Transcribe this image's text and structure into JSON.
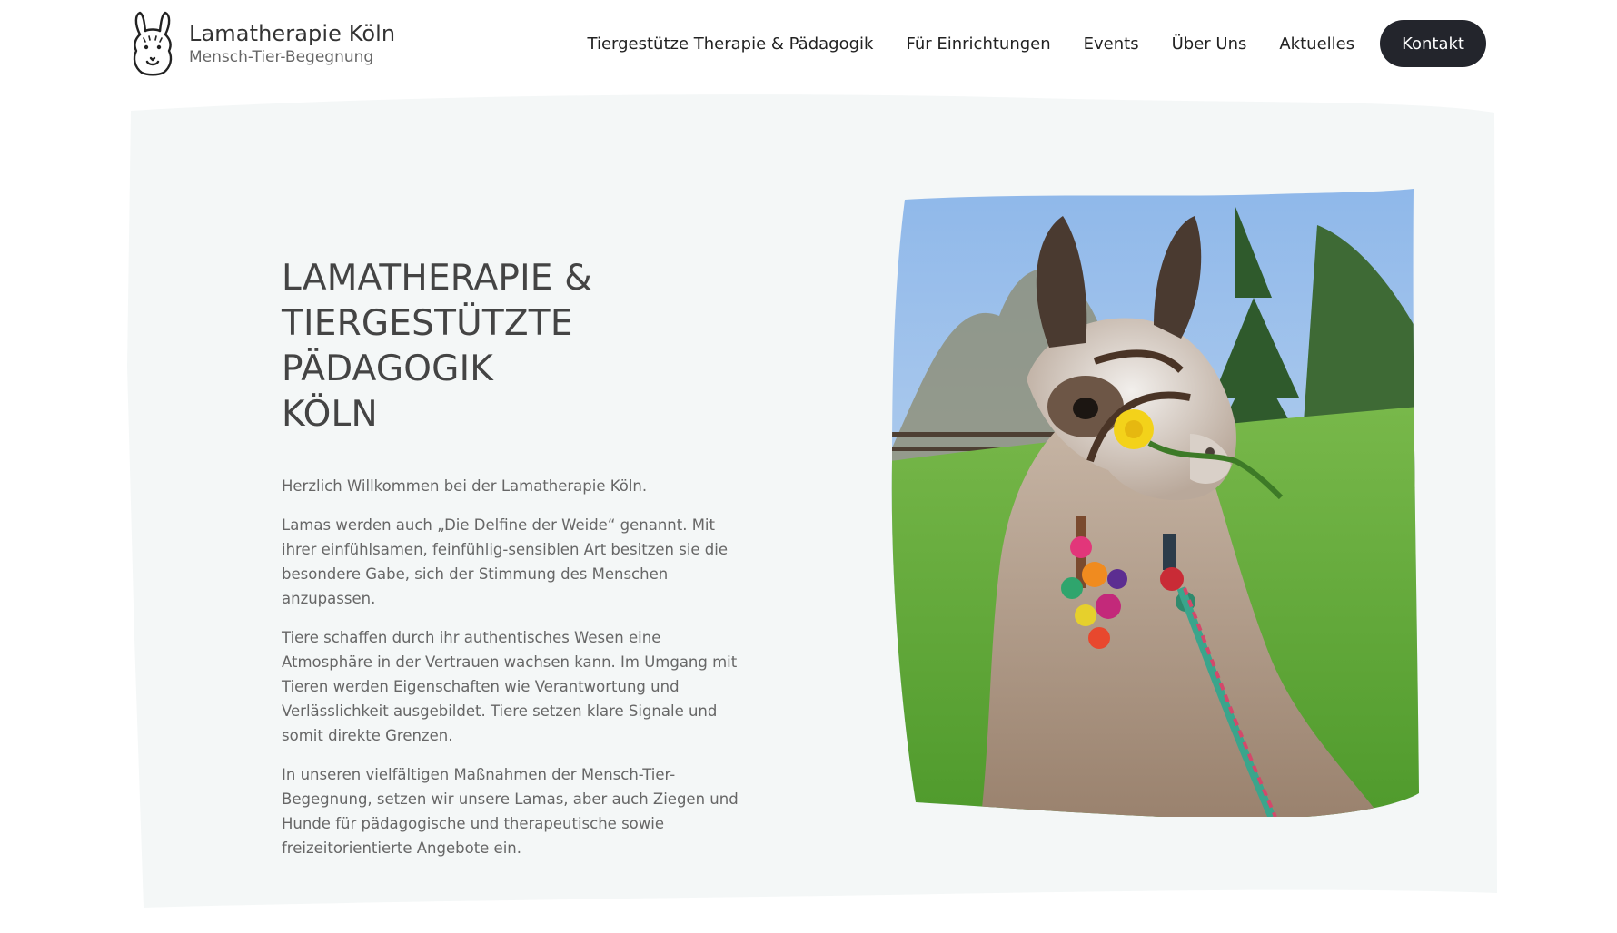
{
  "header": {
    "logo": {
      "icon": "llama-head-icon",
      "title": "Lamatherapie Köln",
      "subtitle": "Mensch-Tier-Begegnung"
    },
    "nav": [
      {
        "label": "Tiergestütze Therapie & Pädagogik"
      },
      {
        "label": "Für Einrichtungen"
      },
      {
        "label": "Events"
      },
      {
        "label": "Über Uns"
      },
      {
        "label": "Aktuelles"
      }
    ],
    "cta_label": "Kontakt"
  },
  "hero": {
    "title_lines": [
      "LAMATHERAPIE &",
      "TIERGESTÜTZTE PÄDAGOGIK",
      "KÖLN"
    ],
    "paragraphs": [
      "Herzlich Willkommen bei der Lamatherapie Köln.",
      "Lamas werden auch „Die Delfine der Weide“ genannt. Mit ihrer einfühlsamen, feinfühlig-sensiblen Art besitzen sie die besondere Gabe, sich der Stimmung des Menschen anzupassen.",
      "Tiere schaffen durch ihr authentisches Wesen eine Atmosphäre in der Vertrauen wachsen kann. Im Umgang mit Tieren werden Eigenschaften wie Verantwortung und Verlässlichkeit ausgebildet. Tiere setzen klare Signale und somit direkte Grenzen.",
      "In unseren vielfältigen Maßnahmen der Mensch-Tier-Begegnung, setzen wir unsere Lamas, aber auch Ziegen und Hunde für pädagogische und therapeutische sowie freizeitorientierte Angebote ein."
    ],
    "image": "llama-photo"
  },
  "colors": {
    "hero_background": "#f4f7f7",
    "button_background": "#23252c",
    "button_text": "#ffffff",
    "heading": "#444444",
    "body_text": "#666666"
  }
}
